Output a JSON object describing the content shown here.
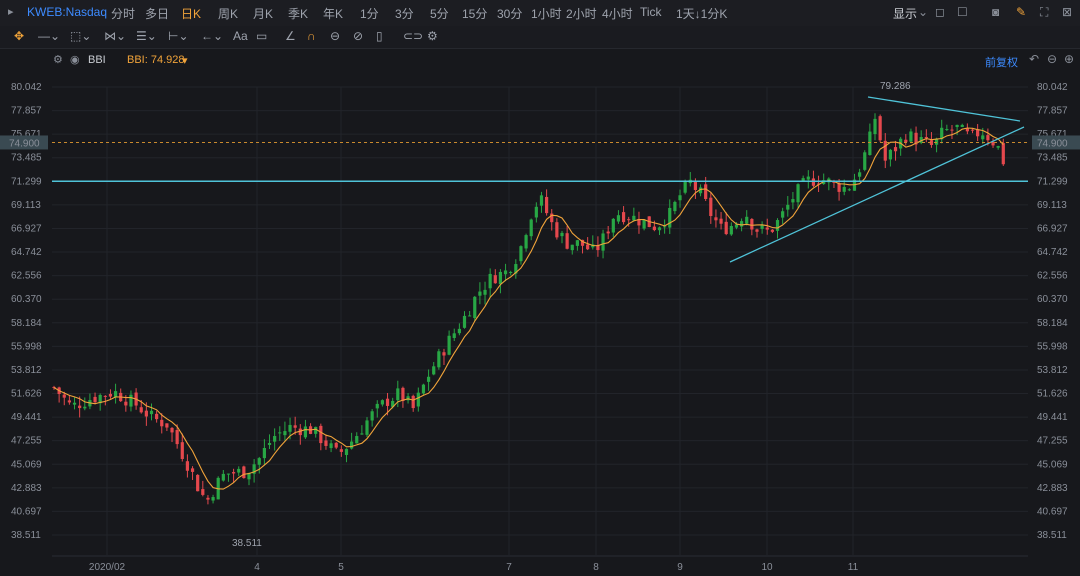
{
  "header": {
    "symbol": "KWEB:Nasdaq",
    "timeframes": [
      "分时",
      "多日",
      "日K",
      "周K",
      "月K",
      "季K",
      "年K",
      "1分",
      "3分",
      "5分",
      "15分",
      "30分",
      "1小时",
      "2小时",
      "4小时",
      "Tick",
      "1天↓1分K"
    ],
    "active_timeframe": "日K",
    "display_label": "显示",
    "chevron_icon": "chevron-down"
  },
  "toolbar": {
    "items": [
      "crosshair",
      "line",
      "rect",
      "pattern",
      "fib",
      "channel",
      "arrow",
      "text",
      "note",
      "eraser",
      "magnet",
      "clock",
      "hide",
      "trash",
      "link",
      "settings"
    ],
    "text_tool_label": "Aa"
  },
  "indicator": {
    "name": "BBI",
    "value_label": "BBI: 74.928",
    "restore_label": "前复权"
  },
  "chart_data": {
    "type": "candlestick",
    "y_ticks": [
      "80.042",
      "77.857",
      "75.671",
      "73.485",
      "71.299",
      "69.113",
      "66.927",
      "64.742",
      "62.556",
      "60.370",
      "58.184",
      "55.998",
      "53.812",
      "51.626",
      "49.441",
      "47.255",
      "45.069",
      "42.883",
      "40.697",
      "38.511"
    ],
    "ylim": [
      38.511,
      80.042
    ],
    "x_ticks": [
      "2020/02",
      "4",
      "5",
      "7",
      "8",
      "9",
      "10",
      "11"
    ],
    "current_price": "74.900",
    "horizontal_line": 71.299,
    "high_annotation": "79.286",
    "low_annotation": "38.511",
    "colors": {
      "up": "#28a745",
      "down": "#e5484d",
      "bbi": "#f0a33a",
      "trend": "#4fc3d8",
      "bg": "#17181c"
    }
  }
}
